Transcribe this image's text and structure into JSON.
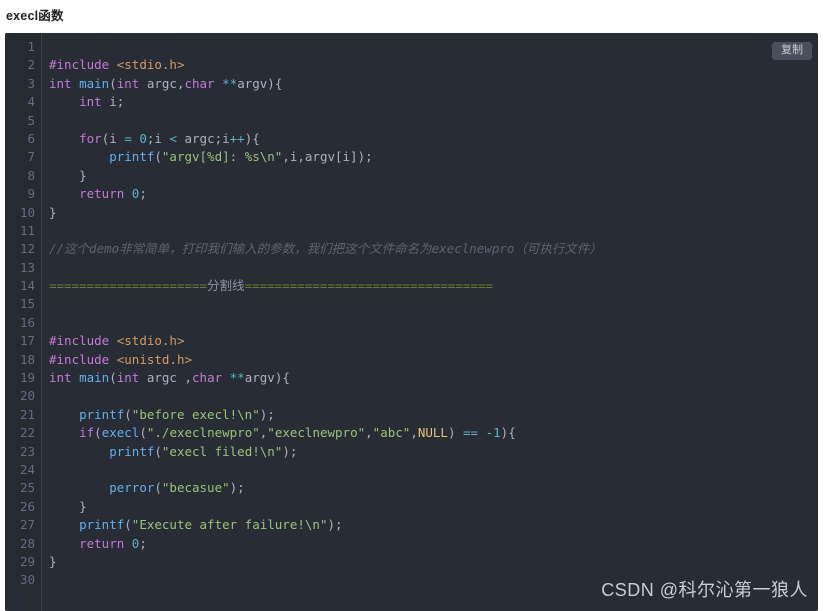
{
  "page": {
    "title": "execl函数",
    "watermark": "CSDN @科尔沁第一狼人"
  },
  "code_block": {
    "copy_label": "复制",
    "language": "c",
    "theme": "one-dark",
    "background_color": "#282c34",
    "gutter_color": "#262a31",
    "line_number_color": "#636d83",
    "total_lines": 30,
    "line_numbers": [
      1,
      2,
      3,
      4,
      5,
      6,
      7,
      8,
      9,
      10,
      11,
      12,
      13,
      14,
      15,
      16,
      17,
      18,
      19,
      20,
      21,
      22,
      23,
      24,
      25,
      26,
      27,
      28,
      29,
      30
    ],
    "lines": [
      "",
      "#include <stdio.h>",
      "int main(int argc,char **argv){",
      "    int i;",
      "",
      "    for(i = 0;i < argc;i++){",
      "        printf(\"argv[%d]: %s\\n\",i,argv[i]);",
      "    }",
      "    return 0;",
      "}",
      "",
      "//这个demo非常简单，打印我们输入的参数，我们把这个文件命名为execlnewpro（可执行文件）",
      "",
      "=====================分割线=================================",
      "",
      "",
      "#include <stdio.h>",
      "#include <unistd.h>",
      "int main(int argc ,char **argv){",
      "",
      "    printf(\"before execl!\\n\");",
      "    if(execl(\"./execlnewpro\",\"execlnewpro\",\"abc\",NULL) == -1){",
      "        printf(\"execl filed!\\n\");",
      "",
      "        perror(\"becasue\");",
      "    }",
      "    printf(\"Execute after failure!\\n\");",
      "    return 0;",
      "}",
      ""
    ],
    "tokens": {
      "line_2": [
        {
          "t": "#include",
          "c": "t-pre"
        },
        {
          "t": " ",
          "c": "t-punc"
        },
        {
          "t": "<stdio.h>",
          "c": "t-hdr"
        }
      ],
      "line_3": [
        {
          "t": "int",
          "c": "t-kw"
        },
        {
          "t": " ",
          "c": "t-punc"
        },
        {
          "t": "main",
          "c": "t-fn"
        },
        {
          "t": "(",
          "c": "t-punc"
        },
        {
          "t": "int",
          "c": "t-kw"
        },
        {
          "t": " argc,",
          "c": "t-var"
        },
        {
          "t": "char",
          "c": "t-kw"
        },
        {
          "t": " ",
          "c": "t-punc"
        },
        {
          "t": "**",
          "c": "t-op"
        },
        {
          "t": "argv){",
          "c": "t-var"
        }
      ],
      "line_4": [
        {
          "t": "    ",
          "c": "t-punc"
        },
        {
          "t": "int",
          "c": "t-kw"
        },
        {
          "t": " i;",
          "c": "t-var"
        }
      ],
      "line_6": [
        {
          "t": "    ",
          "c": "t-punc"
        },
        {
          "t": "for",
          "c": "t-kw"
        },
        {
          "t": "(i ",
          "c": "t-var"
        },
        {
          "t": "=",
          "c": "t-op"
        },
        {
          "t": " ",
          "c": "t-punc"
        },
        {
          "t": "0",
          "c": "t-num"
        },
        {
          "t": ";i ",
          "c": "t-var"
        },
        {
          "t": "<",
          "c": "t-op"
        },
        {
          "t": " argc;i",
          "c": "t-var"
        },
        {
          "t": "++",
          "c": "t-op"
        },
        {
          "t": "){",
          "c": "t-var"
        }
      ],
      "line_7": [
        {
          "t": "        ",
          "c": "t-punc"
        },
        {
          "t": "printf",
          "c": "t-fn"
        },
        {
          "t": "(",
          "c": "t-punc"
        },
        {
          "t": "\"argv[%d]: %s\\n\"",
          "c": "t-str"
        },
        {
          "t": ",i,argv[i]);",
          "c": "t-var"
        }
      ],
      "line_8": [
        {
          "t": "    }",
          "c": "t-punc"
        }
      ],
      "line_9": [
        {
          "t": "    ",
          "c": "t-punc"
        },
        {
          "t": "return",
          "c": "t-kw"
        },
        {
          "t": " ",
          "c": "t-punc"
        },
        {
          "t": "0",
          "c": "t-num"
        },
        {
          "t": ";",
          "c": "t-punc"
        }
      ],
      "line_10": [
        {
          "t": "}",
          "c": "t-punc"
        }
      ],
      "line_12": [
        {
          "t": "//这个demo非常简单，打印我们输入的参数，我们把这个文件命名为execlnewpro（可执行文件）",
          "c": "t-com"
        }
      ],
      "line_14": [
        {
          "t": "=====================",
          "c": "t-sep"
        },
        {
          "t": "分割线",
          "c": "t-septxt"
        },
        {
          "t": "=================================",
          "c": "t-sep"
        }
      ],
      "line_17": [
        {
          "t": "#include",
          "c": "t-pre"
        },
        {
          "t": " ",
          "c": "t-punc"
        },
        {
          "t": "<stdio.h>",
          "c": "t-hdr"
        }
      ],
      "line_18": [
        {
          "t": "#include",
          "c": "t-pre"
        },
        {
          "t": " ",
          "c": "t-punc"
        },
        {
          "t": "<unistd.h>",
          "c": "t-hdr"
        }
      ],
      "line_19": [
        {
          "t": "int",
          "c": "t-kw"
        },
        {
          "t": " ",
          "c": "t-punc"
        },
        {
          "t": "main",
          "c": "t-fn"
        },
        {
          "t": "(",
          "c": "t-punc"
        },
        {
          "t": "int",
          "c": "t-kw"
        },
        {
          "t": " argc ,",
          "c": "t-var"
        },
        {
          "t": "char",
          "c": "t-kw"
        },
        {
          "t": " ",
          "c": "t-punc"
        },
        {
          "t": "**",
          "c": "t-op"
        },
        {
          "t": "argv){",
          "c": "t-var"
        }
      ],
      "line_21": [
        {
          "t": "    ",
          "c": "t-punc"
        },
        {
          "t": "printf",
          "c": "t-fn"
        },
        {
          "t": "(",
          "c": "t-punc"
        },
        {
          "t": "\"before execl!\\n\"",
          "c": "t-str"
        },
        {
          "t": ");",
          "c": "t-punc"
        }
      ],
      "line_22": [
        {
          "t": "    ",
          "c": "t-punc"
        },
        {
          "t": "if",
          "c": "t-kw"
        },
        {
          "t": "(",
          "c": "t-punc"
        },
        {
          "t": "execl",
          "c": "t-fn"
        },
        {
          "t": "(",
          "c": "t-punc"
        },
        {
          "t": "\"./execlnewpro\"",
          "c": "t-str"
        },
        {
          "t": ",",
          "c": "t-punc"
        },
        {
          "t": "\"execlnewpro\"",
          "c": "t-str"
        },
        {
          "t": ",",
          "c": "t-punc"
        },
        {
          "t": "\"abc\"",
          "c": "t-str"
        },
        {
          "t": ",",
          "c": "t-punc"
        },
        {
          "t": "NULL",
          "c": "t-const"
        },
        {
          "t": ") ",
          "c": "t-punc"
        },
        {
          "t": "==",
          "c": "t-op"
        },
        {
          "t": " ",
          "c": "t-punc"
        },
        {
          "t": "-1",
          "c": "t-num"
        },
        {
          "t": "){",
          "c": "t-punc"
        }
      ],
      "line_23": [
        {
          "t": "        ",
          "c": "t-punc"
        },
        {
          "t": "printf",
          "c": "t-fn"
        },
        {
          "t": "(",
          "c": "t-punc"
        },
        {
          "t": "\"execl filed!\\n\"",
          "c": "t-str"
        },
        {
          "t": ");",
          "c": "t-punc"
        }
      ],
      "line_25": [
        {
          "t": "        ",
          "c": "t-punc"
        },
        {
          "t": "perror",
          "c": "t-fn"
        },
        {
          "t": "(",
          "c": "t-punc"
        },
        {
          "t": "\"becasue\"",
          "c": "t-str"
        },
        {
          "t": ");",
          "c": "t-punc"
        }
      ],
      "line_26": [
        {
          "t": "    }",
          "c": "t-punc"
        }
      ],
      "line_27": [
        {
          "t": "    ",
          "c": "t-punc"
        },
        {
          "t": "printf",
          "c": "t-fn"
        },
        {
          "t": "(",
          "c": "t-punc"
        },
        {
          "t": "\"Execute after failure!\\n\"",
          "c": "t-str"
        },
        {
          "t": ");",
          "c": "t-punc"
        }
      ],
      "line_28": [
        {
          "t": "    ",
          "c": "t-punc"
        },
        {
          "t": "return",
          "c": "t-kw"
        },
        {
          "t": " ",
          "c": "t-punc"
        },
        {
          "t": "0",
          "c": "t-num"
        },
        {
          "t": ";",
          "c": "t-punc"
        }
      ],
      "line_29": [
        {
          "t": "}",
          "c": "t-punc"
        }
      ]
    }
  }
}
